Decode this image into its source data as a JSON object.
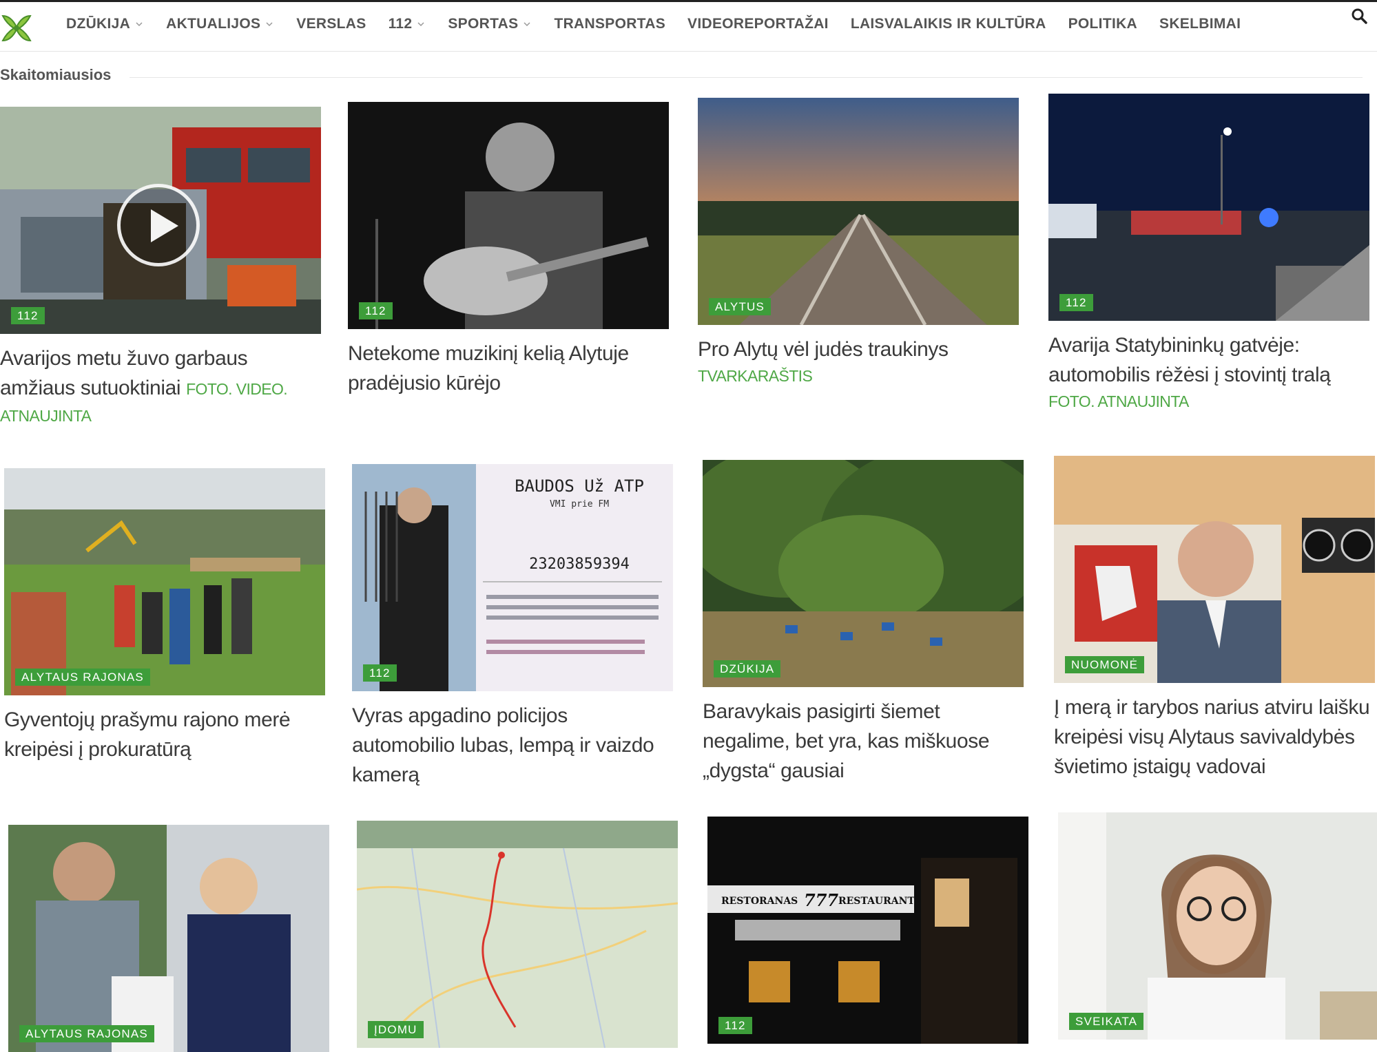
{
  "nav": {
    "items": [
      {
        "label": "DZŪKIJA",
        "dropdown": true
      },
      {
        "label": "AKTUALIJOS",
        "dropdown": true
      },
      {
        "label": "VERSLAS",
        "dropdown": false
      },
      {
        "label": "112",
        "dropdown": true
      },
      {
        "label": "SPORTAS",
        "dropdown": true
      },
      {
        "label": "TRANSPORTAS",
        "dropdown": false
      },
      {
        "label": "VIDEOREPORTAŽAI",
        "dropdown": false
      },
      {
        "label": "LAISVALAIKIS IR KULTŪRA",
        "dropdown": false
      },
      {
        "label": "POLITIKA",
        "dropdown": false
      },
      {
        "label": "SKELBIMAI",
        "dropdown": false
      }
    ],
    "search_icon": "search-icon",
    "logo_icon": "site-logo-icon"
  },
  "section": {
    "title": "Skaitomiausios"
  },
  "colors": {
    "accent": "#3d9d3a",
    "tag_text": "#4fa846",
    "title_text": "#3a3a3a",
    "nav_text": "#555555"
  },
  "articles": [
    {
      "badge": "112",
      "title": "Avarijos metu žuvo garbaus amžiaus sutuoktiniai",
      "tag": "FOTO. VIDEO.",
      "tagline": "ATNAUJINTA",
      "has_video": true,
      "image": "car-crash-rescue"
    },
    {
      "badge": "112",
      "title": "Netekome muzikinį kelią Alytuje pradėjusio kūrėjo",
      "tag": "",
      "tagline": "",
      "has_video": false,
      "image": "guitarist-bw"
    },
    {
      "badge": "ALYTUS",
      "title": "Pro Alytų vėl judės traukinys",
      "tag": "",
      "tagline": "TVARKARAŠTIS",
      "has_video": false,
      "image": "railway-sunset"
    },
    {
      "badge": "112",
      "title": "Avarija Statybininkų gatvėje: automobilis rėžėsi į stovintį tralą",
      "tag": "",
      "tagline": "FOTO. ATNAUJINTA",
      "has_video": false,
      "image": "night-accident"
    },
    {
      "badge": "ALYTAUS RAJONAS",
      "title": "Gyventojų prašymu rajono merė kreipėsi į prokuratūrą",
      "tag": "",
      "tagline": "",
      "has_video": false,
      "image": "people-field"
    },
    {
      "badge": "112",
      "title": "Vyras apgadino policijos automobilio lubas, lempą ir vaizdo kamerą",
      "tag": "",
      "tagline": "",
      "has_video": false,
      "image": "man-pitchfork-receipt"
    },
    {
      "badge": "DZŪKIJA",
      "title": "Baravykais pasigirti šiemet negalime, bet yra, kas miškuose „dygsta“ gausiai",
      "tag": "",
      "tagline": "",
      "has_video": false,
      "image": "forest-litter"
    },
    {
      "badge": "NUOMONĖ",
      "title": "Į merą ir tarybos narius atviru laišku kreipėsi visų Alytaus savivaldybės švietimo įstaigų vadovai",
      "tag": "",
      "tagline": "",
      "has_video": false,
      "image": "man-office-coat-of-arms"
    },
    {
      "badge": "ALYTAUS RAJONAS",
      "title": "",
      "tag": "",
      "tagline": "",
      "has_video": false,
      "image": "people-greeting"
    },
    {
      "badge": "ĮDOMU",
      "title": "",
      "tag": "",
      "tagline": "",
      "has_video": false,
      "image": "map-route"
    },
    {
      "badge": "112",
      "title": "",
      "tag": "",
      "tagline": "",
      "has_video": false,
      "image": "restaurant-night"
    },
    {
      "badge": "SVEIKATA",
      "title": "",
      "tag": "",
      "tagline": "",
      "has_video": false,
      "image": "woman-glasses"
    }
  ],
  "receipt_text": {
    "heading": "BAUDOS Už ATP",
    "sub": "VMI prie FM",
    "number": "23203859394"
  },
  "restaurant_sign": {
    "left": "RESTORANAS",
    "logo": "777",
    "right": "RESTAURANT"
  }
}
